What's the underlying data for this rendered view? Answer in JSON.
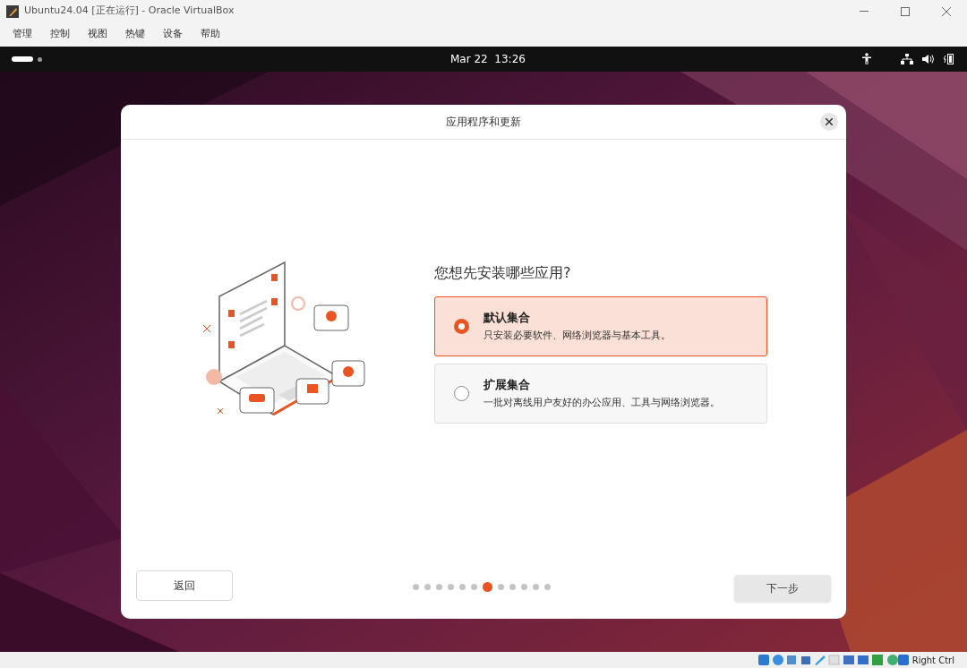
{
  "window": {
    "title": "Ubuntu24.04 [正在运行] - Oracle VirtualBox"
  },
  "menu": [
    "管理",
    "控制",
    "视图",
    "热键",
    "设备",
    "帮助"
  ],
  "top_bar": {
    "clock": "Mar 22  13:26"
  },
  "dialog": {
    "title": "应用程序和更新",
    "question": "您想先安装哪些应用?",
    "options": [
      {
        "title": "默认集合",
        "description": "只安装必要软件、网络浏览器与基本工具。",
        "selected": true
      },
      {
        "title": "扩展集合",
        "description": "一批对离线用户友好的办公应用、工具与网络浏览器。",
        "selected": false
      }
    ],
    "back_button": "返回",
    "next_button": "下一步",
    "steps": [
      {
        "selected": false
      },
      {
        "selected": false
      },
      {
        "selected": false
      },
      {
        "selected": false
      },
      {
        "selected": false
      },
      {
        "selected": false
      },
      {
        "selected": true
      },
      {
        "selected": false
      },
      {
        "selected": false
      },
      {
        "selected": false
      },
      {
        "selected": false
      },
      {
        "selected": false
      }
    ]
  },
  "status_bar": {
    "host_key": "Right Ctrl"
  }
}
